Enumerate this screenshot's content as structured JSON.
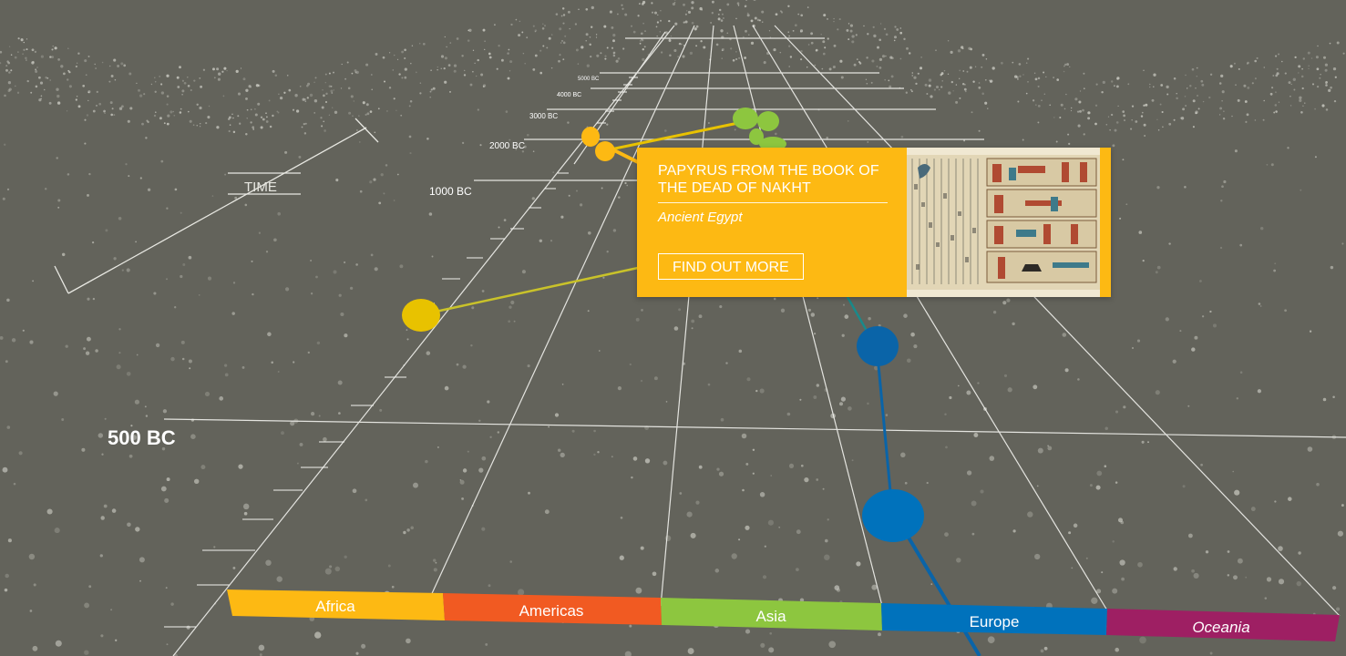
{
  "axis": {
    "time_label": "TIME",
    "ticks": [
      "5000 BC",
      "4000 BC",
      "3000 BC",
      "2000 BC",
      "1000 BC",
      "500 BC"
    ]
  },
  "regions": [
    {
      "label": "Africa",
      "color": "#fdb913"
    },
    {
      "label": "Americas",
      "color": "#f15a22"
    },
    {
      "label": "Asia",
      "color": "#8dc63f"
    },
    {
      "label": "Europe",
      "color": "#0072bc"
    },
    {
      "label": "Oceania",
      "color": "#9e1f63"
    }
  ],
  "popup": {
    "title": "PAPYRUS FROM THE BOOK OF THE DEAD OF NAKHT",
    "culture": "Ancient Egypt",
    "button": "FIND OUT MORE",
    "image_icon": "papyrus-thumbnail"
  },
  "colors": {
    "background": "#63635b",
    "africa": "#fdb913",
    "africa_dark": "#e8c200",
    "asia": "#8dc63f",
    "europe": "#0072bc",
    "europe_dark": "#0a64a8",
    "teal": "#1a8a8a"
  }
}
